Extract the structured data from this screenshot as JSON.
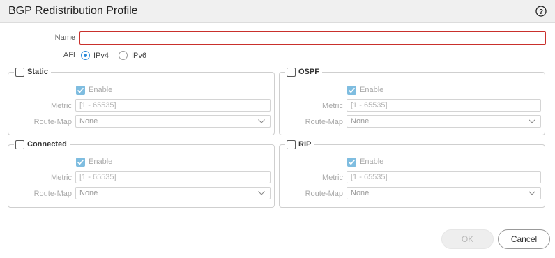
{
  "dialog": {
    "title": "BGP Redistribution Profile",
    "help_icon": "help-icon"
  },
  "form": {
    "name_label": "Name",
    "name_value": "",
    "afi_label": "AFI",
    "afi_options": [
      "IPv4",
      "IPv6"
    ],
    "afi_selected": "IPv4"
  },
  "groups": [
    {
      "title": "Static",
      "checked": false,
      "enable_label": "Enable",
      "enable_checked": true,
      "metric_label": "Metric",
      "metric_placeholder": "[1 - 65535]",
      "route_map_label": "Route-Map",
      "route_map_value": "None"
    },
    {
      "title": "OSPF",
      "checked": false,
      "enable_label": "Enable",
      "enable_checked": true,
      "metric_label": "Metric",
      "metric_placeholder": "[1 - 65535]",
      "route_map_label": "Route-Map",
      "route_map_value": "None"
    },
    {
      "title": "Connected",
      "checked": false,
      "enable_label": "Enable",
      "enable_checked": true,
      "metric_label": "Metric",
      "metric_placeholder": "[1 - 65535]",
      "route_map_label": "Route-Map",
      "route_map_value": "None"
    },
    {
      "title": "RIP",
      "checked": false,
      "enable_label": "Enable",
      "enable_checked": true,
      "metric_label": "Metric",
      "metric_placeholder": "[1 - 65535]",
      "route_map_label": "Route-Map",
      "route_map_value": "None"
    }
  ],
  "buttons": {
    "ok_label": "OK",
    "cancel_label": "Cancel"
  },
  "colors": {
    "accent": "#2b8ad9",
    "error_border": "#c9302c",
    "disabled_check": "#7fbde0"
  }
}
